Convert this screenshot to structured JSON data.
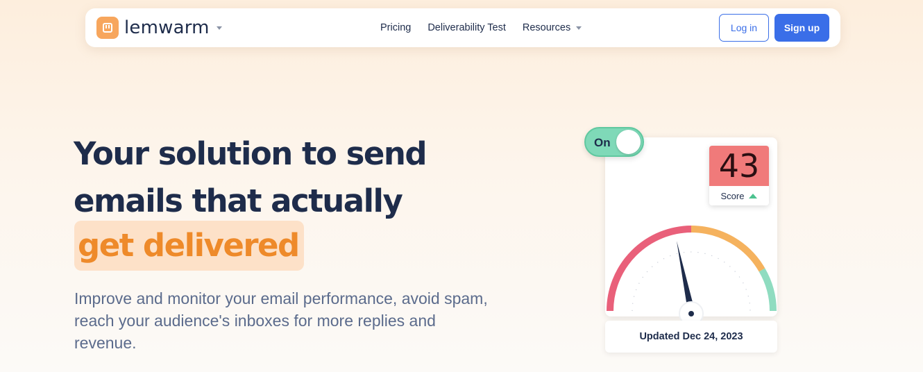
{
  "nav": {
    "brand": "lemwarm",
    "links": [
      "Pricing",
      "Deliverability Test",
      "Resources"
    ],
    "login": "Log in",
    "signup": "Sign up"
  },
  "hero": {
    "headline_line1": "Your solution to send",
    "headline_line2": "emails that actually",
    "headline_accent": "get delivered",
    "subtitle": "Improve and monitor your email performance, avoid spam, reach your audience's inboxes for more replies and revenue."
  },
  "widget": {
    "toggle_label": "On",
    "score": "43",
    "score_label": "Score",
    "updated": "Updated Dec 24, 2023",
    "gauge_colors": [
      "#e9607a",
      "#f5b25e",
      "#8fdcc0"
    ],
    "accent_color": "#ee8a2a",
    "brand_blue": "#3a6ee8"
  }
}
